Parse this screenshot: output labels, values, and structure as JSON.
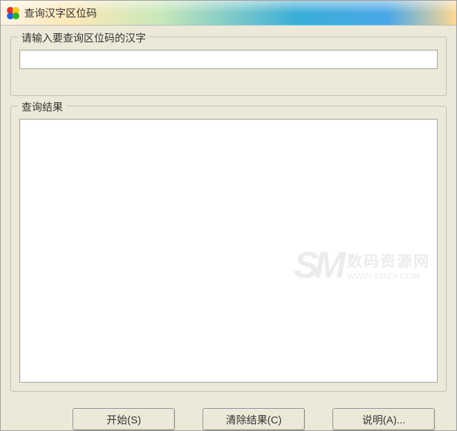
{
  "window": {
    "title": "查询汉字区位码"
  },
  "input_group": {
    "label": "请输入要查询区位码的汉字",
    "value": ""
  },
  "result_group": {
    "label": "查询结果",
    "content": ""
  },
  "buttons": {
    "start": "开始(S)",
    "clear": "清除结果(C)",
    "help": "说明(A)..."
  },
  "watermark": {
    "logo": "SM",
    "cn": "数码资源网",
    "url": "WWW.SMZY.COM"
  }
}
